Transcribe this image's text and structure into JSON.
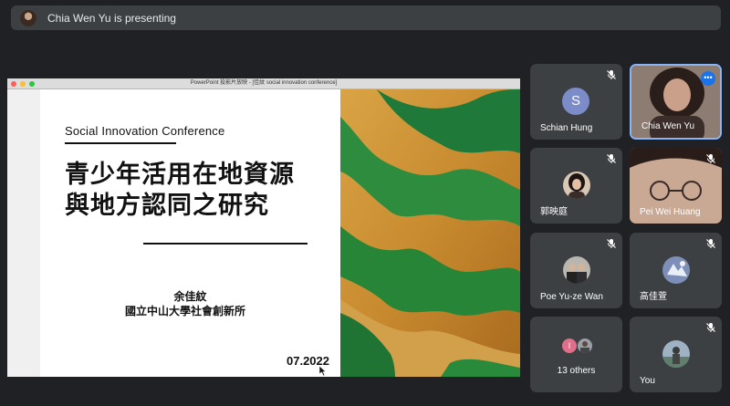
{
  "banner": {
    "presenting_text": "Chia Wen Yu is presenting"
  },
  "presentation": {
    "window_title": "PowerPoint 投影片放映 - [佳紋 social innovation conference]",
    "slide": {
      "heading": "Social Innovation Conference",
      "title_line1": "青少年活用在地資源",
      "title_line2": "與地方認同之研究",
      "author": "余佳紋",
      "affiliation": "國立中山大學社會創新所",
      "date": "07.2022"
    }
  },
  "participants": [
    {
      "name": "Schian Hung",
      "initial": "S",
      "muted": true
    },
    {
      "name": "Chia Wen Yu",
      "muted": false,
      "more_label": "•••"
    },
    {
      "name": "郭映庭",
      "muted": true
    },
    {
      "name": "Pei Wei Huang",
      "muted": true
    },
    {
      "name": "Poe Yu-ze Wan",
      "muted": true
    },
    {
      "name": "高佳萱",
      "muted": true
    },
    {
      "name": "13 others",
      "initial": "I"
    },
    {
      "name": "You",
      "muted": true
    }
  ],
  "colors": {
    "background": "#202124",
    "tile": "#3c4043",
    "active_border": "#8ab4f8",
    "accent": "#1a73e8"
  }
}
